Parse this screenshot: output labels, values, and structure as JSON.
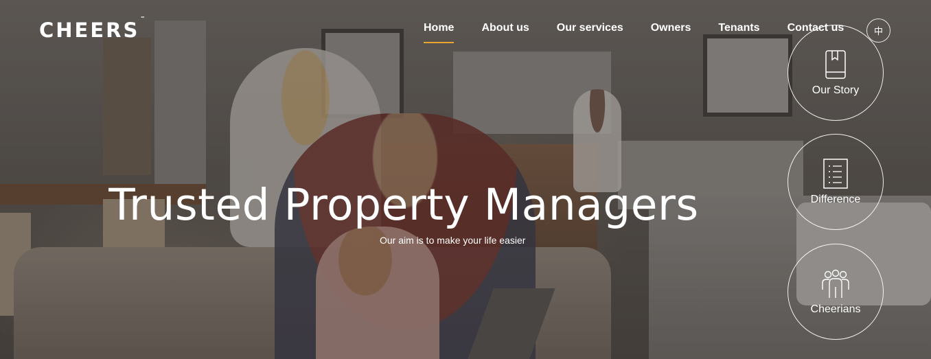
{
  "brand": {
    "logo_text": "CHEERS",
    "trademark": "™"
  },
  "nav": {
    "items": [
      {
        "label": "Home",
        "active": true
      },
      {
        "label": "About us",
        "active": false
      },
      {
        "label": "Our services",
        "active": false
      },
      {
        "label": "Owners",
        "active": false
      },
      {
        "label": "Tenants",
        "active": false
      },
      {
        "label": "Contact us",
        "active": false
      }
    ]
  },
  "language_toggle": {
    "label": "中"
  },
  "side_links": [
    {
      "label": "Our Story",
      "icon": "book-icon"
    },
    {
      "label": "Difference",
      "icon": "checklist-icon"
    },
    {
      "label": "Cheerians",
      "icon": "people-icon"
    }
  ],
  "hero": {
    "title": "Trusted Property Managers",
    "subtitle": "Our aim is to make your life easier"
  },
  "colors": {
    "accent": "#e8a62e",
    "text": "#ffffff"
  }
}
